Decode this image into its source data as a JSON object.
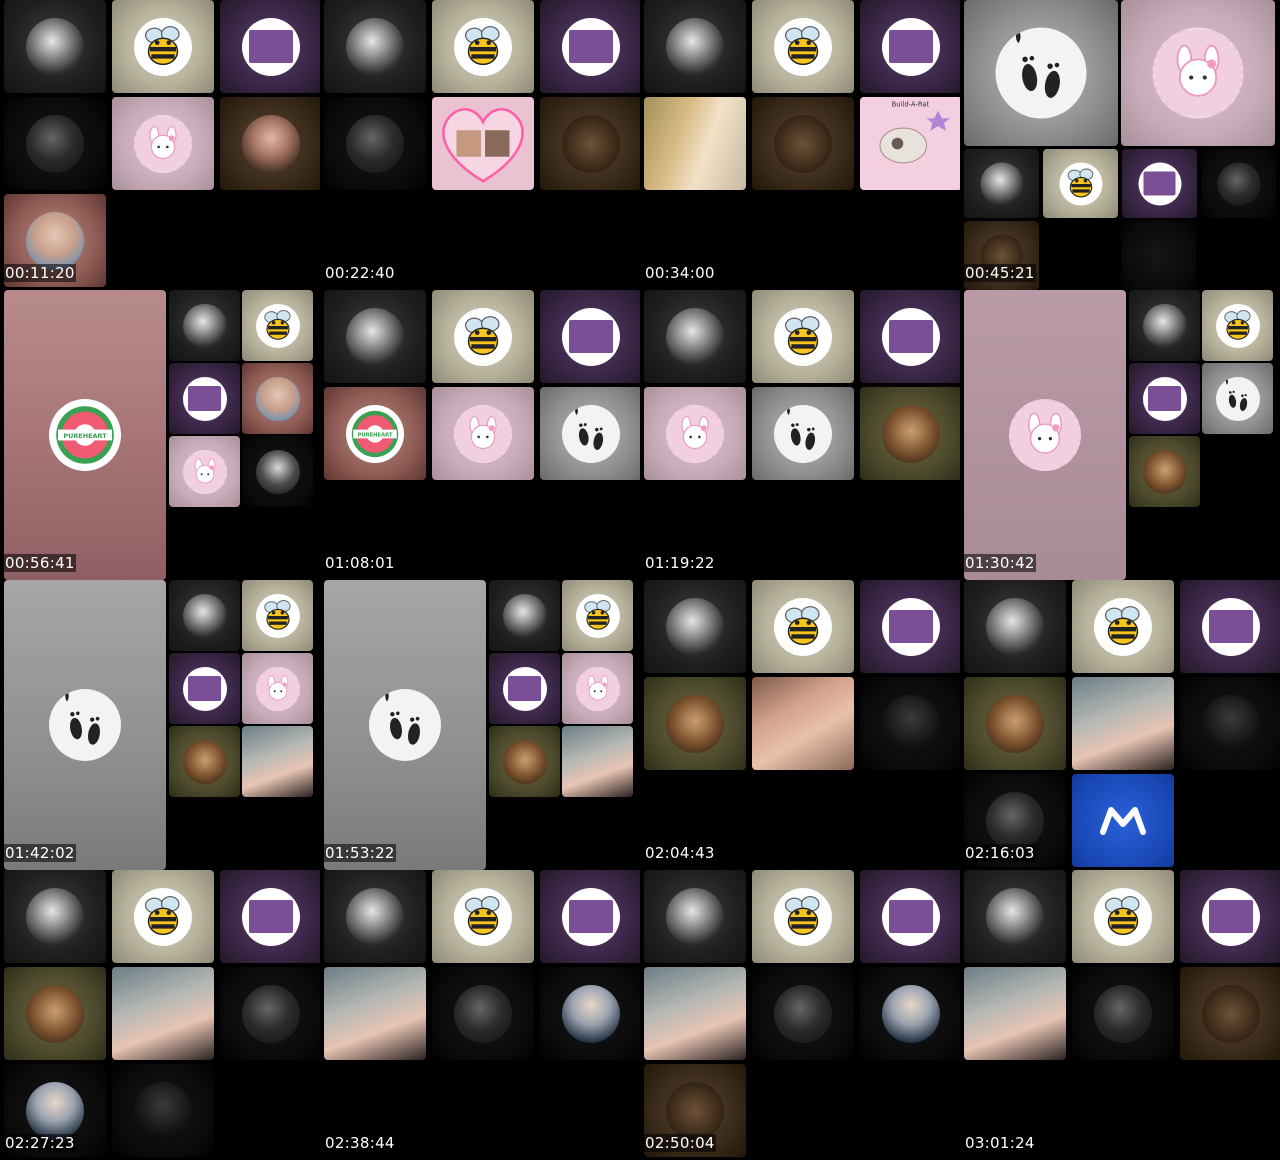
{
  "grid": {
    "columns": 4,
    "timestamps": [
      "00:11:20",
      "00:22:40",
      "00:34:00",
      "00:45:21",
      "00:56:41",
      "01:08:01",
      "01:19:22",
      "01:30:42",
      "01:42:02",
      "01:53:22",
      "02:04:43",
      "02:16:03",
      "02:27:23",
      "02:38:44",
      "02:50:04",
      "03:01:24"
    ]
  },
  "labels": {
    "pureheart": "PUREHEART",
    "buildarat": "Build-A-Rat"
  },
  "colors": {
    "background": "#000000",
    "timestamp_text": "#ffffff",
    "purple_tile": "#3a2646",
    "beige_tile": "#b7b29c",
    "pink_tile": "#c6aab7",
    "blue_tile": "#1a48b6"
  },
  "icons": {
    "bee": "bee-icon",
    "feet": "footprints-icon",
    "melody": "pink-bunny-icon",
    "brand_m": "m-logo-icon"
  }
}
